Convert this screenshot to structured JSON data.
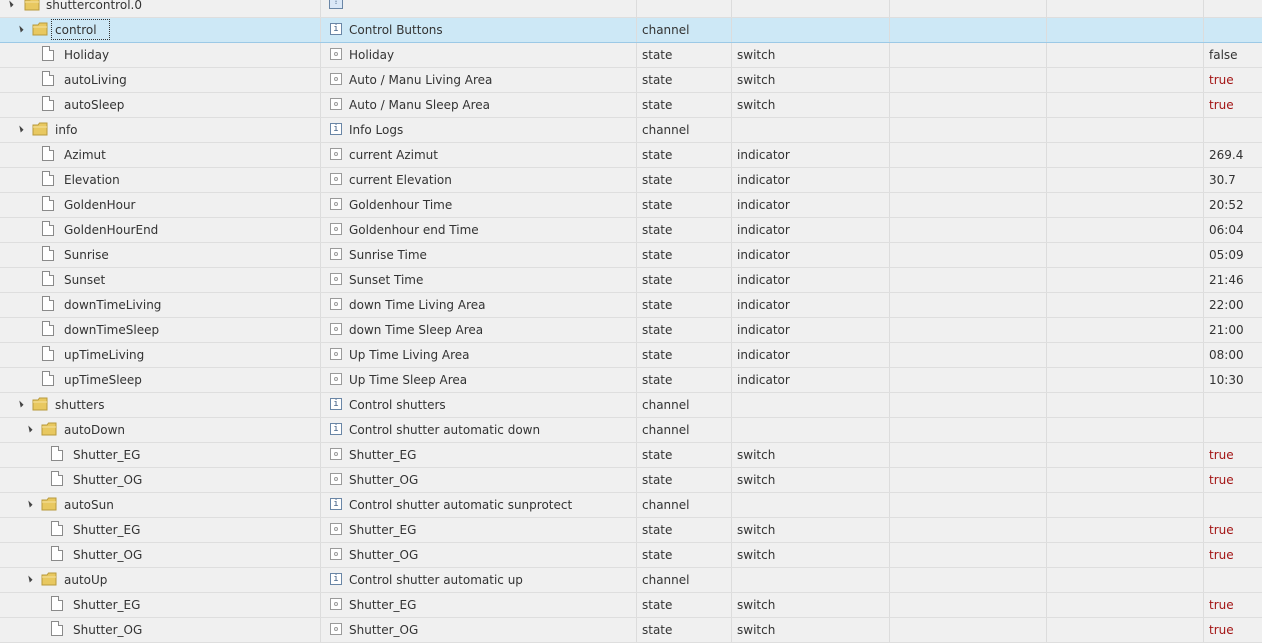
{
  "tree": {
    "root": {
      "name": "shuttercontrol.0",
      "title_icon": "toggle-all-icon"
    },
    "rows": [
      {
        "kind": "folder",
        "depth": 1,
        "name": "control",
        "title": "Control Buttons",
        "type": "channel",
        "role": "",
        "value": "",
        "selected": true
      },
      {
        "kind": "file",
        "depth": 1,
        "name": "Holiday",
        "title": "Holiday",
        "type": "state",
        "role": "switch",
        "value": "false"
      },
      {
        "kind": "file",
        "depth": 1,
        "name": "autoLiving",
        "title": "Auto / Manu Living Area",
        "type": "state",
        "role": "switch",
        "value": "true"
      },
      {
        "kind": "file",
        "depth": 1,
        "name": "autoSleep",
        "title": "Auto / Manu Sleep Area",
        "type": "state",
        "role": "switch",
        "value": "true"
      },
      {
        "kind": "folder",
        "depth": 1,
        "name": "info",
        "title": "Info Logs",
        "type": "channel",
        "role": "",
        "value": ""
      },
      {
        "kind": "file",
        "depth": 1,
        "name": "Azimut",
        "title": "current Azimut",
        "type": "state",
        "role": "indicator",
        "value": "269.4"
      },
      {
        "kind": "file",
        "depth": 1,
        "name": "Elevation",
        "title": "current Elevation",
        "type": "state",
        "role": "indicator",
        "value": "30.7"
      },
      {
        "kind": "file",
        "depth": 1,
        "name": "GoldenHour",
        "title": "Goldenhour Time",
        "type": "state",
        "role": "indicator",
        "value": "20:52"
      },
      {
        "kind": "file",
        "depth": 1,
        "name": "GoldenHourEnd",
        "title": "Goldenhour end Time",
        "type": "state",
        "role": "indicator",
        "value": "06:04"
      },
      {
        "kind": "file",
        "depth": 1,
        "name": "Sunrise",
        "title": "Sunrise Time",
        "type": "state",
        "role": "indicator",
        "value": "05:09"
      },
      {
        "kind": "file",
        "depth": 1,
        "name": "Sunset",
        "title": "Sunset Time",
        "type": "state",
        "role": "indicator",
        "value": "21:46"
      },
      {
        "kind": "file",
        "depth": 1,
        "name": "downTimeLiving",
        "title": "down Time Living Area",
        "type": "state",
        "role": "indicator",
        "value": "22:00"
      },
      {
        "kind": "file",
        "depth": 1,
        "name": "downTimeSleep",
        "title": "down Time Sleep Area",
        "type": "state",
        "role": "indicator",
        "value": "21:00"
      },
      {
        "kind": "file",
        "depth": 1,
        "name": "upTimeLiving",
        "title": "Up Time Living Area",
        "type": "state",
        "role": "indicator",
        "value": "08:00"
      },
      {
        "kind": "file",
        "depth": 1,
        "name": "upTimeSleep",
        "title": "Up Time Sleep Area",
        "type": "state",
        "role": "indicator",
        "value": "10:30"
      },
      {
        "kind": "folder",
        "depth": 1,
        "name": "shutters",
        "title": "Control shutters",
        "type": "channel",
        "role": "",
        "value": ""
      },
      {
        "kind": "folder",
        "depth": 2,
        "name": "autoDown",
        "title": "Control shutter automatic down",
        "type": "channel",
        "role": "",
        "value": ""
      },
      {
        "kind": "file",
        "depth": 2,
        "name": "Shutter_EG",
        "title": "Shutter_EG",
        "type": "state",
        "role": "switch",
        "value": "true"
      },
      {
        "kind": "file",
        "depth": 2,
        "name": "Shutter_OG",
        "title": "Shutter_OG",
        "type": "state",
        "role": "switch",
        "value": "true"
      },
      {
        "kind": "folder",
        "depth": 2,
        "name": "autoSun",
        "title": "Control shutter automatic sunprotect",
        "type": "channel",
        "role": "",
        "value": ""
      },
      {
        "kind": "file",
        "depth": 2,
        "name": "Shutter_EG",
        "title": "Shutter_EG",
        "type": "state",
        "role": "switch",
        "value": "true"
      },
      {
        "kind": "file",
        "depth": 2,
        "name": "Shutter_OG",
        "title": "Shutter_OG",
        "type": "state",
        "role": "switch",
        "value": "true"
      },
      {
        "kind": "folder",
        "depth": 2,
        "name": "autoUp",
        "title": "Control shutter automatic up",
        "type": "channel",
        "role": "",
        "value": ""
      },
      {
        "kind": "file",
        "depth": 2,
        "name": "Shutter_EG",
        "title": "Shutter_EG",
        "type": "state",
        "role": "switch",
        "value": "true"
      },
      {
        "kind": "file",
        "depth": 2,
        "name": "Shutter_OG",
        "title": "Shutter_OG",
        "type": "state",
        "role": "switch",
        "value": "true"
      }
    ]
  },
  "colors": {
    "selected_bg": "#cde8f6",
    "value_true": "#a31515",
    "folder_yellow": "#e8c860"
  }
}
